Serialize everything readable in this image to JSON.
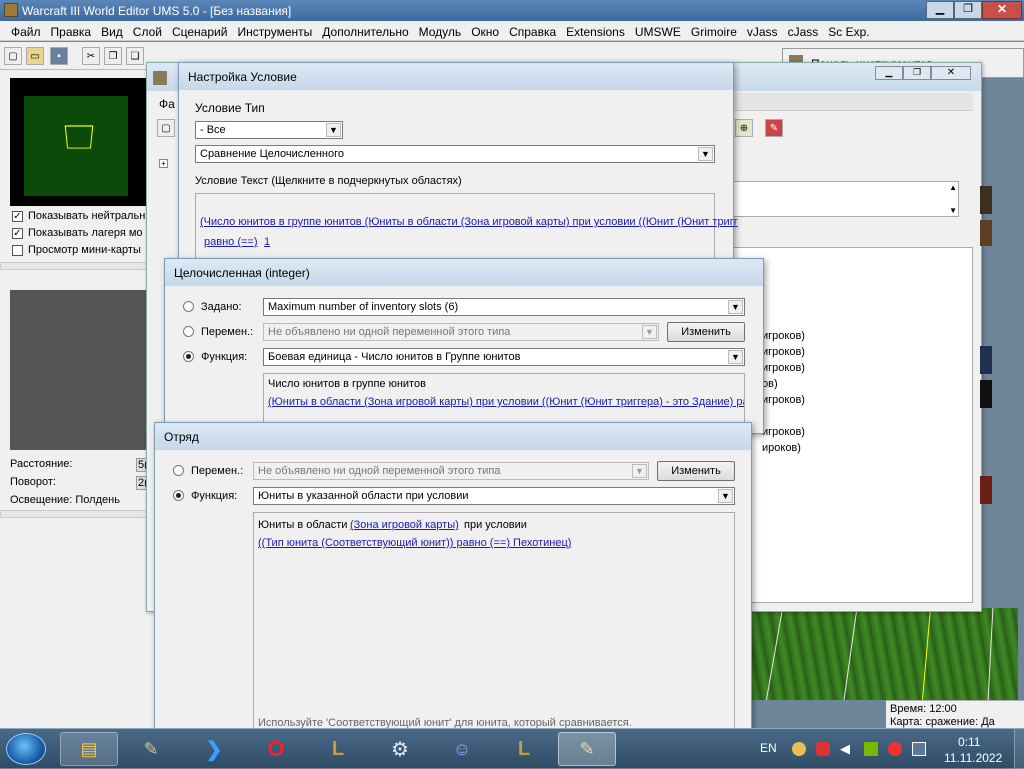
{
  "window": {
    "title": "Warcraft III World Editor UMS 5.0 - [Без названия]"
  },
  "menu": [
    "Файл",
    "Правка",
    "Вид",
    "Слой",
    "Сценарий",
    "Инструменты",
    "Дополнительно",
    "Модуль",
    "Окно",
    "Справка",
    "Extensions",
    "UMSWE",
    "Grimoire",
    "vJass",
    "cJass",
    "Sc Exp."
  ],
  "left": {
    "checks": [
      {
        "label": "Показывать нейтральн",
        "checked": true
      },
      {
        "label": "Показывать лагеря мо",
        "checked": true
      },
      {
        "label": "Просмотр мини-карты",
        "checked": false
      }
    ],
    "info": [
      {
        "label": "Расстояние:",
        "value": "5("
      },
      {
        "label": "Поворот:",
        "value": "2("
      },
      {
        "label": "Освещение: Полдень",
        "value": ""
      }
    ]
  },
  "toolpanel": {
    "title": "Панель инструментов"
  },
  "trigger_window": {
    "menu_partial": "Фа",
    "list": [
      "игроков)",
      "игроков)",
      "игроков)",
      "ов)",
      "игроков)",
      "игроков)",
      "ироков)"
    ]
  },
  "status": {
    "time": "Время: 12:00",
    "map": "Карта: сражение: Да"
  },
  "dlg1": {
    "title": "Настройка Условие",
    "type_label": "Условие Тип",
    "type_value": "- Все",
    "cond_value": "Сравнение Целочисленного",
    "text_label": "Условие Текст (Щелкните в подчеркнутых областях)",
    "text_line1": "(Число юнитов в группе юнитов (Юниты в области (Зона игровой карты) при условии ((Юнит (Юнит тригг",
    "text_line2_link": "равно (==)",
    "text_line2_value": "1"
  },
  "dlg2": {
    "title": "Целочисленная (integer)",
    "r1": "Задано:",
    "r1_value": "Maximum number of inventory slots (6)",
    "r2": "Перемен.:",
    "r2_value": "Не объявлено ни одной переменной этого типа",
    "r3": "Функция:",
    "r3_value": "Боевая единица - Число юнитов в Группе юнитов",
    "change": "Изменить",
    "desc_title": "Число юнитов в группе юнитов",
    "desc_link": "(Юниты в области (Зона игровой карты) при условии ((Юнит (Юнит триггера) - это Здание) равно"
  },
  "dlg3": {
    "title": "Отряд",
    "r1": "Перемен.:",
    "r1_value": "Не объявлено ни одной переменной этого типа",
    "r2": "Функция:",
    "r2_value": "Юниты в указанной области при условии",
    "change": "Изменить",
    "desc_pre": "Юниты в области",
    "desc_link1": "(Зона игровой карты)",
    "desc_post": "при условии",
    "desc_link2": "((Тип юнита (Соответствующий юнит)) равно (==) Пехотинец)",
    "hint": "Используйте 'Соответствующий юнит' для юнита, который сравнивается."
  },
  "taskbar": {
    "lang": "EN",
    "time": "0:11",
    "date": "11.11.2022"
  }
}
